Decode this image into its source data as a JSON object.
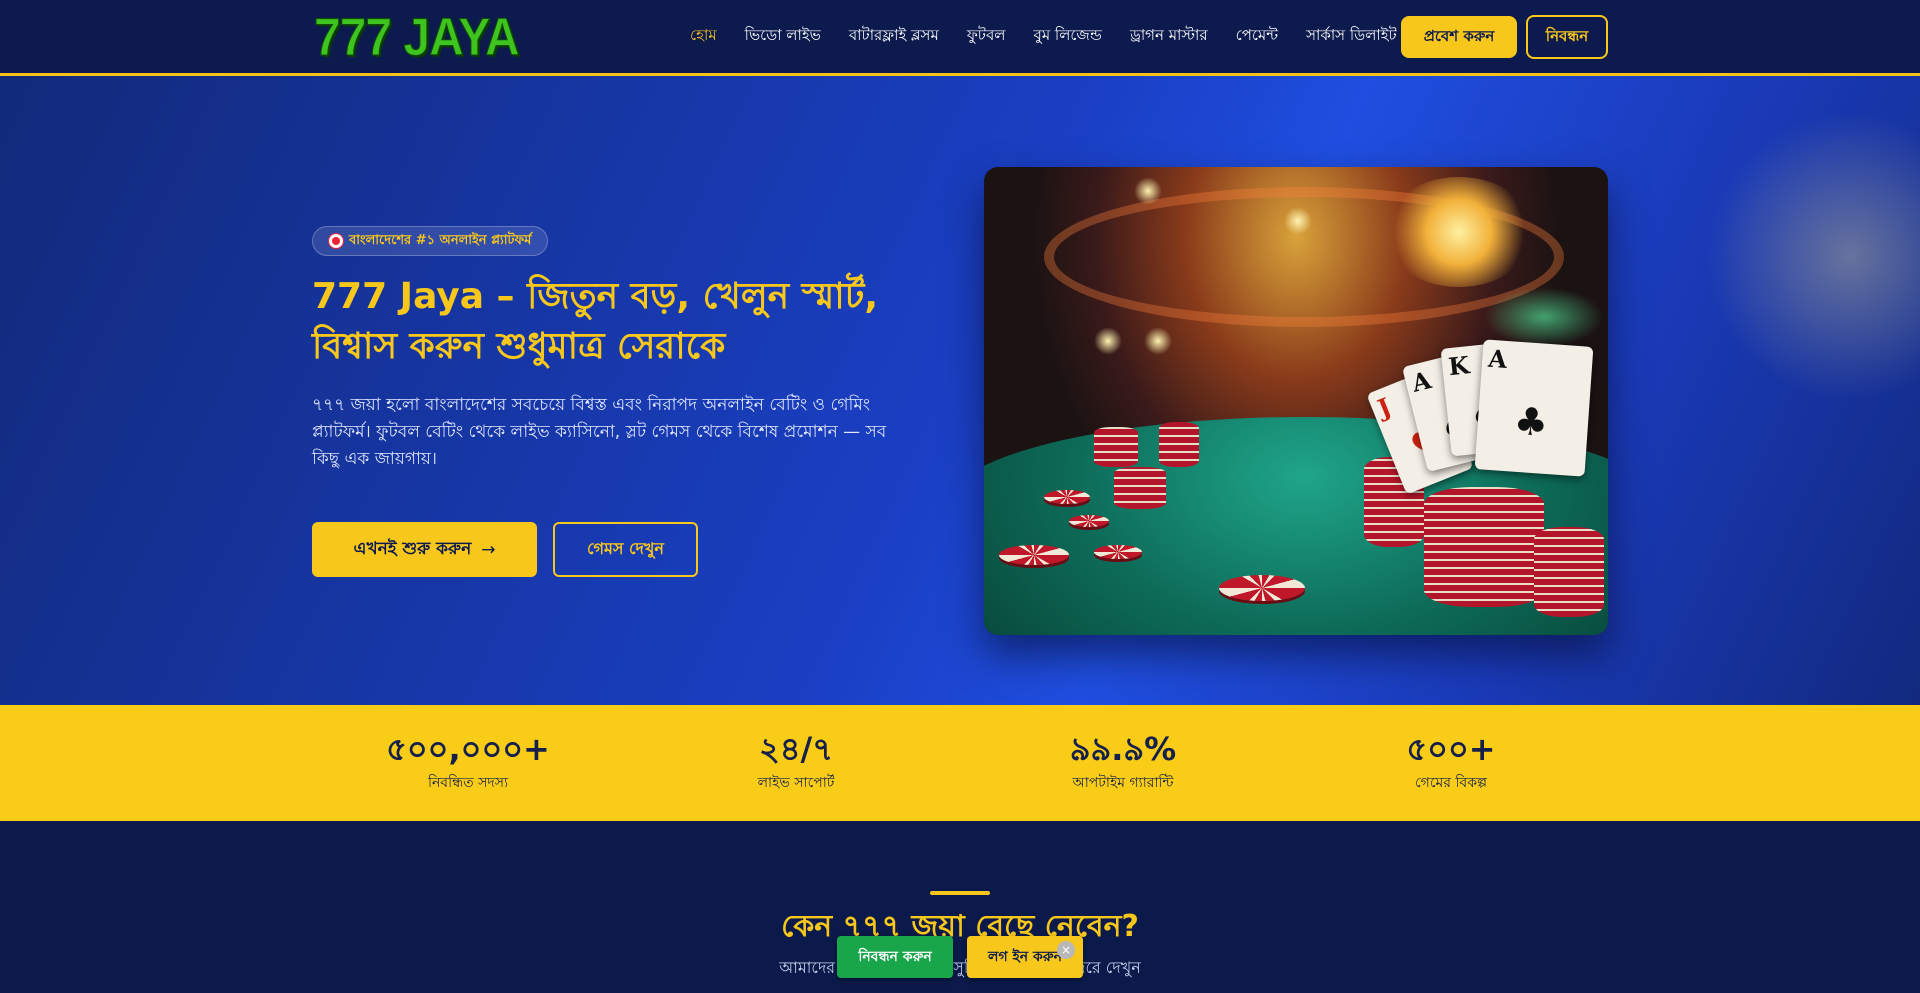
{
  "header": {
    "logo": "777 JAYA",
    "nav": [
      {
        "label": "হোম",
        "active": true
      },
      {
        "label": "ভিডো লাইভ"
      },
      {
        "label": "বাটারফ্লাই ব্লসম"
      },
      {
        "label": "ফুটবল"
      },
      {
        "label": "বুম লিজেন্ড"
      },
      {
        "label": "ড্রাগন মাস্টার"
      },
      {
        "label": "পেমেন্ট"
      },
      {
        "label": "সার্কাস ডিলাইট"
      }
    ],
    "login_label": "প্রবেশ করুন",
    "register_label": "নিবন্ধন"
  },
  "hero": {
    "badge": "বাংলাদেশের #১ অনলাইন প্ল্যাটফর্ম",
    "title": "777 Jaya – জিতুন বড়, খেলুন স্মার্ট, বিশ্বাস করুন শুধুমাত্র সেরাকে",
    "description": "৭৭৭ জয়া হলো বাংলাদেশের সবচেয়ে বিশ্বস্ত এবং নিরাপদ অনলাইন বেটিং ও গেমিং প্ল্যাটফর্ম। ফুটবল বেটিং থেকে লাইভ ক্যাসিনো, স্লট গেমস থেকে বিশেষ প্রমোশন — সব কিছু এক জায়গায়।",
    "start_label": "এখনই শুরু করুন",
    "start_arrow": "→",
    "games_label": "গেমস দেখুন"
  },
  "stats": [
    {
      "value": "৫০০,০০০+",
      "label": "নিবন্ধিত সদস্য"
    },
    {
      "value": "২৪/৭",
      "label": "লাইভ সাপোর্ট"
    },
    {
      "value": "৯৯.৯%",
      "label": "আপটাইম গ্যারান্টি"
    },
    {
      "value": "৫০০+",
      "label": "গেমের বিকল্প"
    }
  ],
  "why": {
    "title": "কেন ৭৭৭ জয়া বেছে নেবেন?",
    "subtitle": "আমাদের প্ল্যাটফর্মের বিশেষ সুবিধাগুলো এক নজরে দেখুন"
  },
  "floating": {
    "register_label": "নিবন্ধন করুন",
    "login_label": "লগ ইন করুন",
    "close_label": "×"
  },
  "colors": {
    "accent": "#f8c71b",
    "header_bg": "#0c1a4d",
    "hero_blue": "#1f4ee0",
    "register_green": "#19a64a"
  },
  "icons": {
    "badge": "target-icon",
    "start_button": "arrow-right-icon",
    "close": "close-icon"
  }
}
